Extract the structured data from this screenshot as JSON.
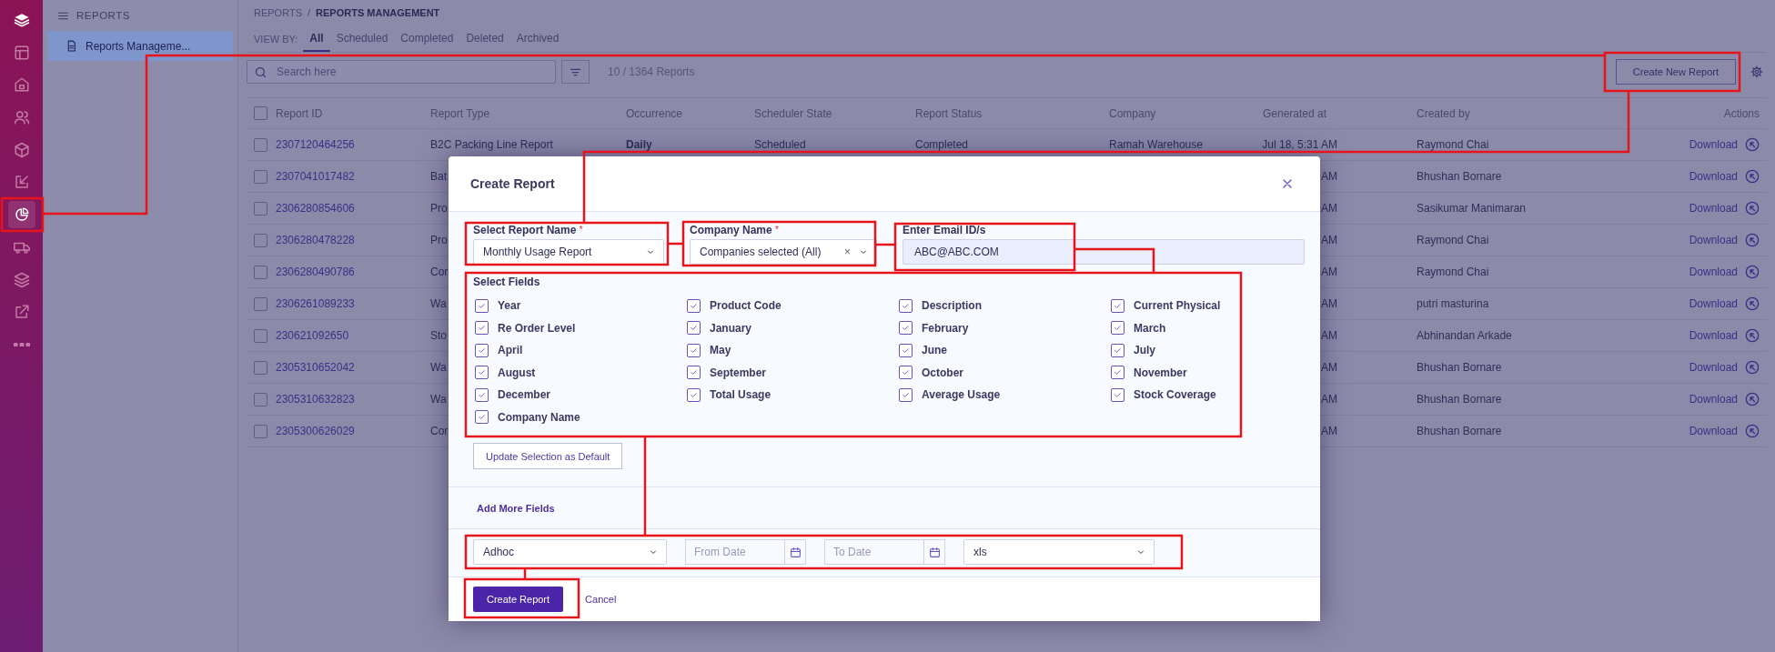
{
  "rail": {
    "items": [
      {
        "selected": false
      },
      {
        "selected": false
      },
      {
        "selected": false
      },
      {
        "selected": false
      },
      {
        "selected": false
      },
      {
        "selected": false
      },
      {
        "selected": true
      },
      {
        "selected": false
      },
      {
        "selected": false
      },
      {
        "selected": false
      },
      {
        "selected": false
      }
    ]
  },
  "panel": {
    "title": "REPORTS",
    "items": [
      {
        "label": "Reports Manageme...",
        "selected": true
      }
    ]
  },
  "breadcrumb": {
    "items": [
      "REPORTS",
      "REPORTS MANAGEMENT"
    ],
    "separator": "/"
  },
  "view_by": {
    "label": "VIEW BY:",
    "tabs": [
      {
        "label": "All",
        "selected": true
      },
      {
        "label": "Scheduled",
        "selected": false
      },
      {
        "label": "Completed",
        "selected": false
      },
      {
        "label": "Deleted",
        "selected": false
      },
      {
        "label": "Archived",
        "selected": false
      }
    ]
  },
  "toolbar": {
    "search": {
      "placeholder": "Search here"
    },
    "count": "10 / 1364 Reports",
    "create_button": "Create New Report"
  },
  "table": {
    "select_all_checked": false,
    "columns": [
      "Report ID",
      "Report Type",
      "Occurrence",
      "Scheduler State",
      "Report Status",
      "Company",
      "Generated at",
      "Created by",
      "Actions"
    ],
    "rows": [
      {
        "checked": false,
        "id": "2307120464256",
        "type": "B2C Packing Line Report",
        "occurrence": "Daily",
        "scheduler_state": "Scheduled",
        "status": "Completed",
        "company": "Ramah Warehouse",
        "generated": "Jul 18, 5:31 AM",
        "created_by": "Raymond Chai",
        "action": "Download"
      },
      {
        "checked": false,
        "id": "2307041017482",
        "type": "Bat",
        "generated": "AM",
        "created_by": "Bhushan Bornare",
        "action": "Download"
      },
      {
        "checked": false,
        "id": "2306280854606",
        "type": "Pro",
        "generated": "AM",
        "created_by": "Sasikumar Manimaran",
        "action": "Download"
      },
      {
        "checked": false,
        "id": "2306280478228",
        "type": "Pro",
        "generated": "AM",
        "created_by": "Raymond Chai",
        "action": "Download"
      },
      {
        "checked": false,
        "id": "2306280490786",
        "type": "Cor",
        "generated": "AM",
        "created_by": "Raymond Chai",
        "action": "Download"
      },
      {
        "checked": false,
        "id": "2306261089233",
        "type": "Wa",
        "generated": "AM",
        "created_by": "putri masturina",
        "action": "Download"
      },
      {
        "checked": false,
        "id": "230621092650",
        "type": "Sto",
        "generated": "AM",
        "created_by": "Abhinandan Arkade",
        "action": "Download"
      },
      {
        "checked": false,
        "id": "2305310652042",
        "type": "Wa",
        "generated": "AM",
        "created_by": "Bhushan Bornare",
        "action": "Download"
      },
      {
        "checked": false,
        "id": "2305310632823",
        "type": "Wa",
        "generated": "AM",
        "created_by": "Bhushan Bornare",
        "action": "Download"
      },
      {
        "checked": false,
        "id": "2305300626029",
        "type": "Cor",
        "generated": "AM",
        "created_by": "Bhushan Bornare",
        "action": "Download"
      }
    ]
  },
  "modal": {
    "title": "Create Report",
    "fields": [
      {
        "kind": "select",
        "label": "Select Report Name",
        "required_mark": "*",
        "value": "Monthly Usage Report"
      },
      {
        "kind": "multiselect",
        "label": "Company Name",
        "required_mark": "*",
        "value": "Companies selected (All)",
        "clear": "×"
      },
      {
        "kind": "text",
        "label": "Enter Email ID/s",
        "value": "ABC@ABC.COM"
      }
    ],
    "select_fields": {
      "label": "Select Fields",
      "options": [
        {
          "label": "Year",
          "checked": true
        },
        {
          "label": "Product Code",
          "checked": true
        },
        {
          "label": "Description",
          "checked": true
        },
        {
          "label": "Current Physical",
          "checked": true
        },
        {
          "label": "Re Order Level",
          "checked": true
        },
        {
          "label": "January",
          "checked": true
        },
        {
          "label": "February",
          "checked": true
        },
        {
          "label": "March",
          "checked": true
        },
        {
          "label": "April",
          "checked": true
        },
        {
          "label": "May",
          "checked": true
        },
        {
          "label": "June",
          "checked": true
        },
        {
          "label": "July",
          "checked": true
        },
        {
          "label": "August",
          "checked": true
        },
        {
          "label": "September",
          "checked": true
        },
        {
          "label": "October",
          "checked": true
        },
        {
          "label": "November",
          "checked": true
        },
        {
          "label": "December",
          "checked": true
        },
        {
          "label": "Total Usage",
          "checked": true
        },
        {
          "label": "Average Usage",
          "checked": true
        },
        {
          "label": "Stock Coverage",
          "checked": true
        },
        {
          "label": "Company Name",
          "checked": true
        }
      ]
    },
    "update_button": "Update Selection as Default",
    "add_more": "Add More Fields",
    "schedule": [
      {
        "kind": "select",
        "value": "Adhoc"
      },
      {
        "kind": "date",
        "placeholder": "From Date"
      },
      {
        "kind": "date",
        "placeholder": "To Date"
      },
      {
        "kind": "select",
        "value": "xls"
      }
    ],
    "submit_button": "Create Report",
    "cancel": "Cancel"
  }
}
